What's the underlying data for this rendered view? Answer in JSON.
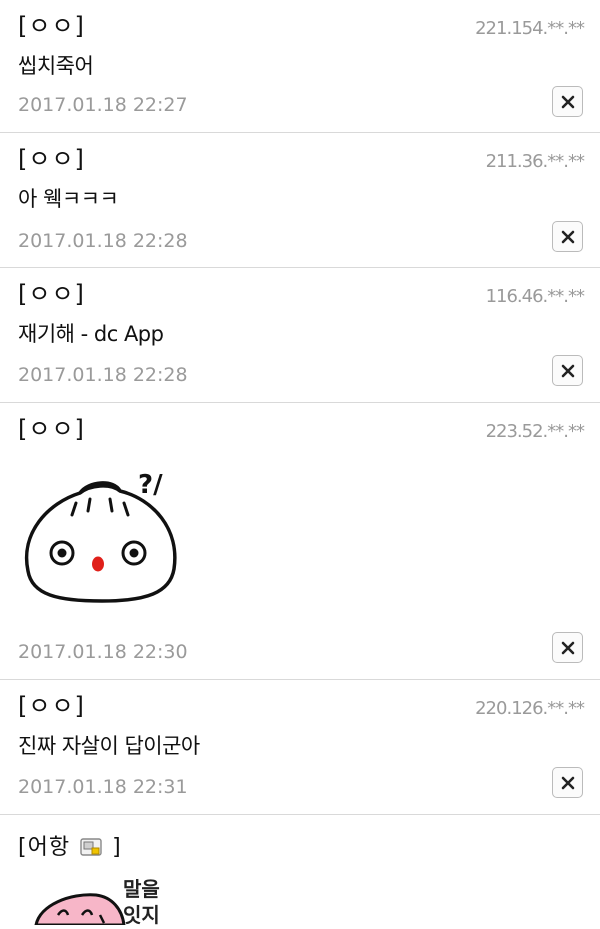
{
  "comments": [
    {
      "author": "[ㅇㅇ]",
      "ip": "221.154.**.**",
      "text": "씹치죽어",
      "date": "2017.01.18 22:27"
    },
    {
      "author": "[ㅇㅇ]",
      "ip": "211.36.**.**",
      "text": "아 웩ㅋㅋㅋ",
      "date": "2017.01.18 22:28"
    },
    {
      "author": "[ㅇㅇ]",
      "ip": "116.46.**.**",
      "text": "재기해 - dc App",
      "date": "2017.01.18 22:28"
    },
    {
      "author": "[ㅇㅇ]",
      "ip": "223.52.**.**",
      "sticker": "dumpling-sticker",
      "date": "2017.01.18 22:30"
    },
    {
      "author": "[ㅇㅇ]",
      "ip": "220.126.**.**",
      "text": "진짜 자살이 답이군아",
      "date": "2017.01.18 22:31"
    }
  ],
  "last_comment": {
    "author_open": "[어항",
    "author_close": "]",
    "badge_icon": "user-badge-icon",
    "sticker_text_1": "말을",
    "sticker_text_2": "잇지"
  },
  "delete_icon": "close-icon",
  "colors": {
    "meta_text": "#9a9a9a",
    "divider": "#d9d9d9",
    "text": "#111111",
    "sticker_mouth": "#e0201a"
  }
}
